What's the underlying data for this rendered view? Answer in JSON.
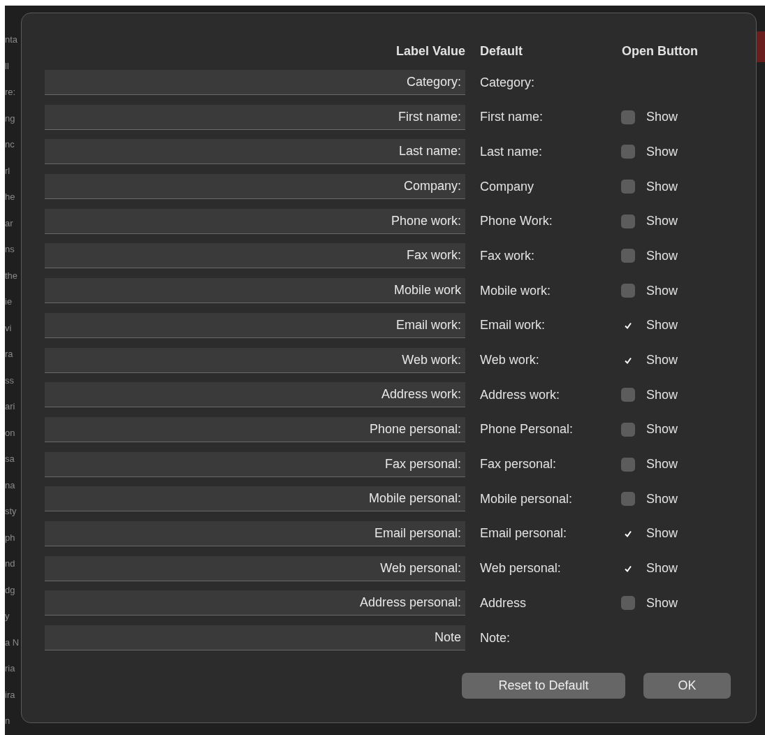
{
  "background_list": [
    "nta",
    "ll",
    "re:",
    "ng",
    "nc",
    "rl",
    "he",
    "ar",
    "ns",
    "the",
    "ie",
    "vi",
    "ra",
    "ss",
    "ari",
    "on",
    "sa",
    "na",
    "sty",
    "ph",
    "nd",
    "dg",
    "y",
    "a N",
    "ria",
    "ira",
    "n"
  ],
  "headers": {
    "label_value": "Label Value",
    "default": "Default",
    "open_button": "Open Button"
  },
  "rows": [
    {
      "kind": "plain",
      "value": "Category:",
      "default": "Category:"
    },
    {
      "kind": "checkbox",
      "value": "First name:",
      "default": "First name:",
      "checked": false,
      "check_label": "Show"
    },
    {
      "kind": "checkbox",
      "value": "Last name:",
      "default": "Last name:",
      "checked": false,
      "check_label": "Show"
    },
    {
      "kind": "checkbox",
      "value": "Company:",
      "default": "Company",
      "checked": false,
      "check_label": "Show"
    },
    {
      "kind": "checkbox",
      "value": "Phone work:",
      "default": "Phone Work:",
      "checked": false,
      "check_label": "Show"
    },
    {
      "kind": "checkbox",
      "value": "Fax work:",
      "default": "Fax work:",
      "checked": false,
      "check_label": "Show"
    },
    {
      "kind": "checkbox",
      "value": "Mobile work",
      "default": "Mobile work:",
      "checked": false,
      "check_label": "Show"
    },
    {
      "kind": "checkbox",
      "value": "Email work:",
      "default": "Email work:",
      "checked": true,
      "check_label": "Show"
    },
    {
      "kind": "checkbox",
      "value": "Web work:",
      "default": "Web work:",
      "checked": true,
      "check_label": "Show"
    },
    {
      "kind": "checkbox",
      "value": "Address work:",
      "default": "Address work:",
      "checked": false,
      "check_label": "Show"
    },
    {
      "kind": "checkbox",
      "value": "Phone personal:",
      "default": "Phone Personal:",
      "checked": false,
      "check_label": "Show"
    },
    {
      "kind": "checkbox",
      "value": "Fax personal:",
      "default": "Fax personal:",
      "checked": false,
      "check_label": "Show"
    },
    {
      "kind": "checkbox",
      "value": "Mobile personal:",
      "default": "Mobile personal:",
      "checked": false,
      "check_label": "Show"
    },
    {
      "kind": "checkbox",
      "value": "Email personal:",
      "default": "Email personal:",
      "checked": true,
      "check_label": "Show"
    },
    {
      "kind": "checkbox",
      "value": "Web personal:",
      "default": "Web personal:",
      "checked": true,
      "check_label": "Show"
    },
    {
      "kind": "checkbox",
      "value": "Address personal:",
      "default": "Address",
      "checked": false,
      "check_label": "Show"
    },
    {
      "kind": "plain",
      "value": "Note",
      "default": "Note:"
    }
  ],
  "buttons": [
    "Reset to Default",
    "OK"
  ]
}
